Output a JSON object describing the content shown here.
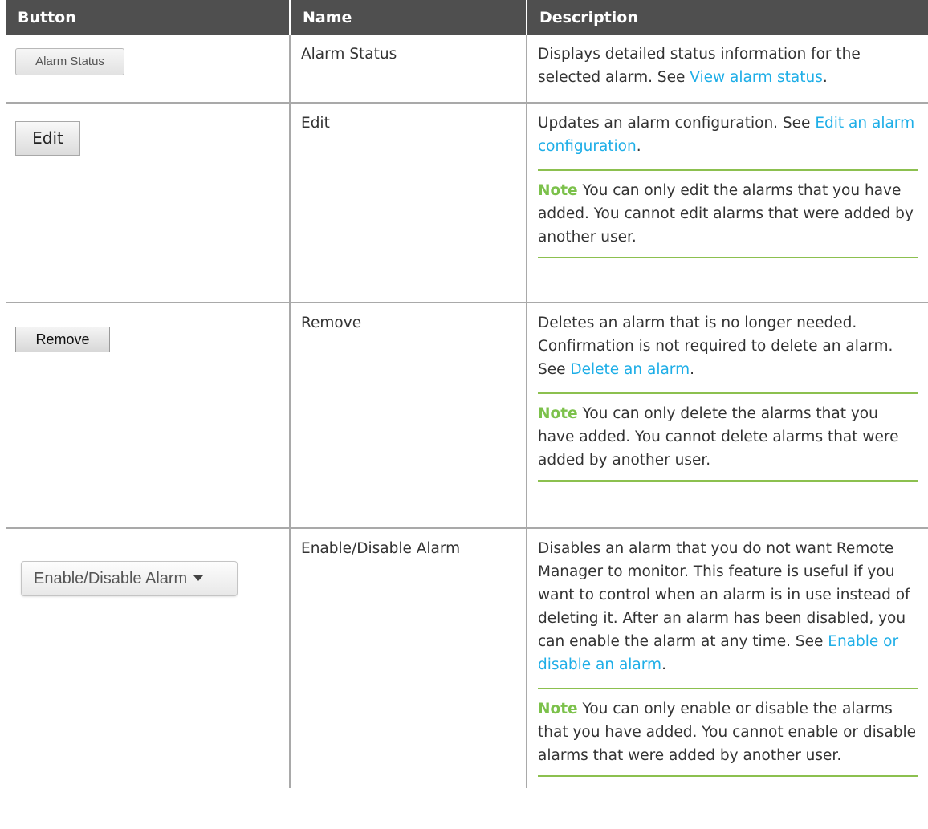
{
  "headers": {
    "button": "Button",
    "name": "Name",
    "description": "Description"
  },
  "rows": [
    {
      "button_label": "Alarm Status",
      "name": "Alarm Status",
      "description": "Displays detailed status information for the selected alarm. See ",
      "link": "View alarm status",
      "tail": "."
    },
    {
      "button_label": "Edit",
      "name": "Edit",
      "description": "Updates an alarm configuration. See ",
      "link": "Edit an alarm configuration",
      "tail": ".",
      "note_label": "Note",
      "note": " You can only edit the alarms that you have added. You cannot edit alarms that were added by another user."
    },
    {
      "button_label": "Remove",
      "name": "Remove",
      "description": "Deletes an alarm that is no longer needed. Confirmation is not required to delete an alarm. See ",
      "link": "Delete an alarm",
      "tail": ".",
      "note_label": "Note",
      "note": " You can only delete the alarms that you have added. You cannot delete alarms that were added by another user."
    },
    {
      "button_label": "Enable/Disable Alarm",
      "name": "Enable/Disable Alarm",
      "description": "Disables an alarm that you do not want Remote Manager to monitor. This feature is useful if you want to control when an alarm is in use instead of deleting it. After an alarm has been disabled, you can enable the alarm at any time. See ",
      "link": "Enable or disable an alarm",
      "tail": ".",
      "note_label": "Note",
      "note": " You can only enable or disable the alarms that you have added. You cannot enable or disable alarms that were added by another user."
    }
  ],
  "colors": {
    "header_bg": "#4f4f4f",
    "link": "#1eaee7",
    "note_accent": "#7cc14b",
    "note_rule": "#8cc04f"
  }
}
